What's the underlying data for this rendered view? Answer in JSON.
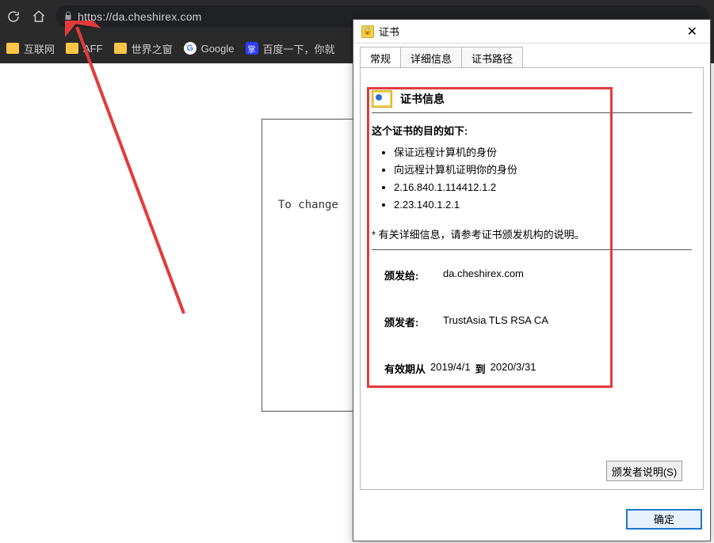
{
  "browser": {
    "url": "https://da.cheshirex.com",
    "bookmarks": [
      {
        "label": "互联网",
        "icon_type": "folder"
      },
      {
        "label": "AFF",
        "icon_type": "folder"
      },
      {
        "label": "世界之窗",
        "icon_type": "folder"
      },
      {
        "label": "Google",
        "icon_type": "g"
      },
      {
        "label": "百度一下，你就",
        "icon_type": "baidu"
      }
    ]
  },
  "page": {
    "truncated_text": "To change"
  },
  "cert_dialog": {
    "title": "证书",
    "tabs": {
      "general": "常规",
      "details": "详细信息",
      "path": "证书路径"
    },
    "info_title": "证书信息",
    "purpose_label": "这个证书的目的如下:",
    "purposes": [
      "保证远程计算机的身份",
      "向远程计算机证明你的身份",
      "2.16.840.1.114412.1.2",
      "2.23.140.1.2.1"
    ],
    "note": "* 有关详细信息，请参考证书颁发机构的说明。",
    "issued_to_label": "颁发给:",
    "issued_to": "da.cheshirex.com",
    "issuer_label": "颁发者:",
    "issuer": "TrustAsia TLS RSA CA",
    "validity_label": "有效期从",
    "validity_from": "2019/4/1",
    "validity_to_word": "到",
    "validity_to": "2020/3/31",
    "issuer_statement_btn": "颁发者说明(S)",
    "ok_btn": "确定"
  }
}
